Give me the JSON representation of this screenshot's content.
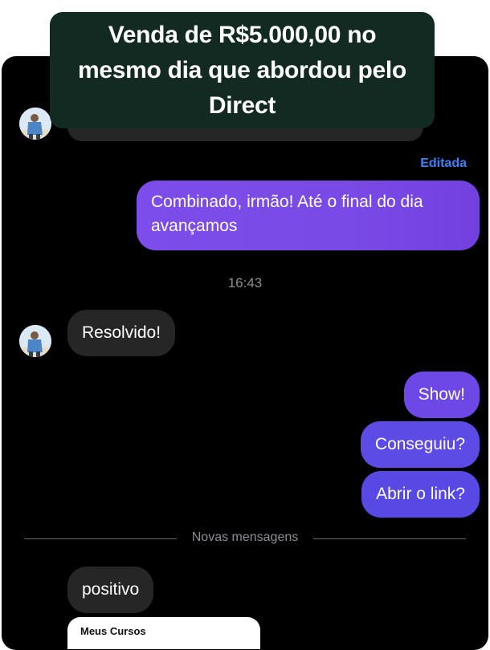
{
  "banner": {
    "text": "Venda de R$5.000,00 no mesmo dia que abordou pelo Direct"
  },
  "chat": {
    "edited_label": "Editada",
    "messages_top": [
      {
        "from": "me",
        "text": "Combinado, irmão! Até o final do dia avançamos"
      }
    ],
    "timestamp": "16:43",
    "incoming_1": "Resolvido!",
    "outgoing": [
      "Show!",
      "Conseguiu?",
      "Abrir o link?"
    ],
    "new_messages_label": "Novas mensagens",
    "incoming_2": "positivo",
    "link_card_title": "Meus Cursos"
  },
  "colors": {
    "outgoing_bubble": "#7b4ae8",
    "incoming_bubble": "#262626",
    "banner_bg": "#132a22",
    "edited_label": "#3b82f6"
  }
}
